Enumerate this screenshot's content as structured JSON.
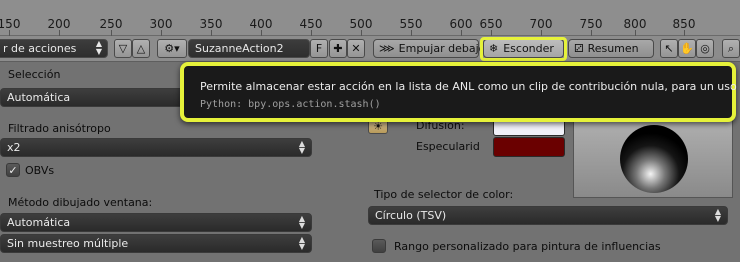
{
  "ruler": {
    "ticks": [
      "150",
      "200",
      "250",
      "300",
      "350",
      "400",
      "450",
      "500",
      "550",
      "600",
      "650",
      "700",
      "750",
      "800",
      "850"
    ]
  },
  "header": {
    "mode_dropdown": "r de acciones",
    "action_name": "SuzanneAction2",
    "fake_user": "F",
    "push_down_label": "Empujar debajo",
    "stash_label": "Esconder",
    "summary_label": "Resumen"
  },
  "tooltip": {
    "description": "Permite almacenar estar acción en la lista de ANL como un clip de contribución nula, para un uso posterior",
    "python": "Python: bpy.ops.action.stash()"
  },
  "left": {
    "selection_label": "Selección",
    "selection_value": "Automática",
    "aniso_label": "Filtrado anisótropo",
    "aniso_value": "x2",
    "obvs_label": "OBVs",
    "window_draw_label": "Método dibujado ventana:",
    "window_draw_value": "Automática",
    "multisample_value": "Sin muestreo múltiple"
  },
  "right": {
    "diffuse_label": "Difusión:",
    "specular_label": "Especularid",
    "color_picker_label": "Tipo de selector de color:",
    "color_picker_value": "Círculo (TSV)",
    "custom_range_label": "Rango personalizado para pintura de influencias"
  },
  "colors": {
    "highlight": "#e6f23a",
    "tooltip_bg": "#1a1a1a",
    "diffuse_swatch": "#f0f0f8",
    "specular_swatch": "#6a0000"
  }
}
